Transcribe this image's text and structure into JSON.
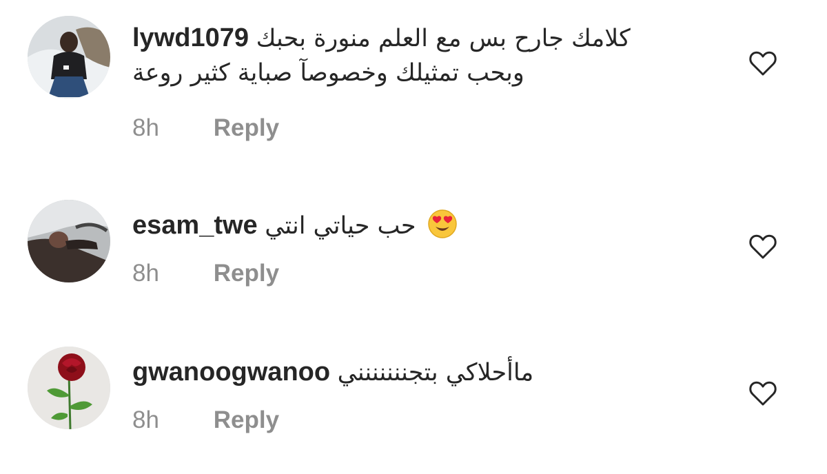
{
  "comments": [
    {
      "username": "lywd1079",
      "text": "كلامك جارح بس مع العلم منورة بحبك",
      "text_line2": "وبحب تمثيلك وخصوصآ صباية كثير روعة",
      "time": "8h",
      "reply_label": "Reply",
      "avatar": "avatar-man-in-snow",
      "like_icon": "heart-outline-icon"
    },
    {
      "username": "esam_twe",
      "text": "حب حياتي انتي",
      "emoji": "heart-eyes-emoji",
      "time": "8h",
      "reply_label": "Reply",
      "avatar": "avatar-man-driving",
      "like_icon": "heart-outline-icon"
    },
    {
      "username": "gwanoogwanoo",
      "text": "ماأحلاكي بتجننننننني",
      "time": "8h",
      "reply_label": "Reply",
      "avatar": "avatar-red-rose",
      "like_icon": "heart-outline-icon"
    }
  ],
  "colors": {
    "text": "#262626",
    "meta": "#8e8e8e",
    "heart_stroke": "#262626"
  }
}
